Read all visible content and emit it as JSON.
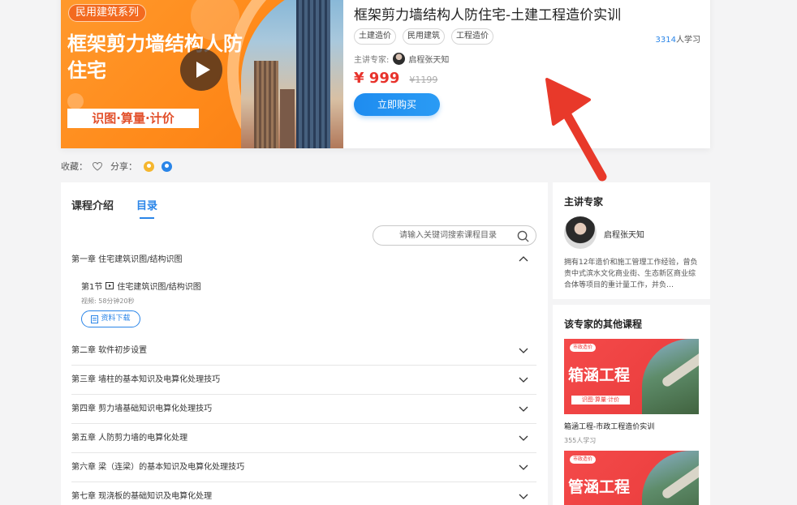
{
  "course": {
    "cover_tag": "民用建筑系列",
    "cover_title": "框架剪力墙结构人防住宅",
    "cover_band": "识图·算量·计价",
    "title": "框架剪力墙结构人防住宅-土建工程造价实训",
    "tags": [
      "土建造价",
      "民用建筑",
      "工程造价"
    ],
    "learners_count": "3314",
    "learners_suffix": "人学习",
    "expert_label": "主讲专家:",
    "expert_name": "启程张天知",
    "price": "¥ 999",
    "original_price": "¥1199",
    "buy_label": "立即购买"
  },
  "actions": {
    "favorite_label": "收藏：",
    "share_label": "分享："
  },
  "tabs": [
    "课程介绍",
    "目录"
  ],
  "search": {
    "placeholder": "请输入关键词搜索课程目录"
  },
  "chapters": [
    "第一章 住宅建筑识图/结构识图",
    "第二章 软件初步设置",
    "第三章 墙柱的基本知识及电算化处理技巧",
    "第四章 剪力墙基础知识电算化处理技巧",
    "第五章 人防剪力墙的电算化处理",
    "第六章 梁（连梁）的基本知识及电算化处理技巧",
    "第七章 现浇板的基础知识及电算化处理"
  ],
  "lesson": {
    "title": "第1节",
    "name": "住宅建筑识图/结构识图",
    "duration": "视频: 58分钟20秒",
    "download_label": "资料下载"
  },
  "expert_panel": {
    "heading": "主讲专家",
    "name": "启程张天知",
    "bio": "拥有12年造价和施工管理工作经验，曾负责中式滨水文化商业街、生态新区商业综合体等项目的重计量工作，并负…"
  },
  "other_courses": {
    "heading": "该专家的其他课程",
    "items": [
      {
        "chip": "市政造价",
        "cover_title": "箱涵工程",
        "band": "识图·算量·计价",
        "title": "箱涵工程-市政工程造价实训",
        "count": "355人学习"
      },
      {
        "chip": "市政造价",
        "cover_title": "管涵工程"
      }
    ]
  },
  "colors": {
    "accent": "#2a85e8",
    "price": "#e8332c",
    "cover_orange": "#ff8a1a",
    "annotation_arrow": "#e8392a"
  }
}
